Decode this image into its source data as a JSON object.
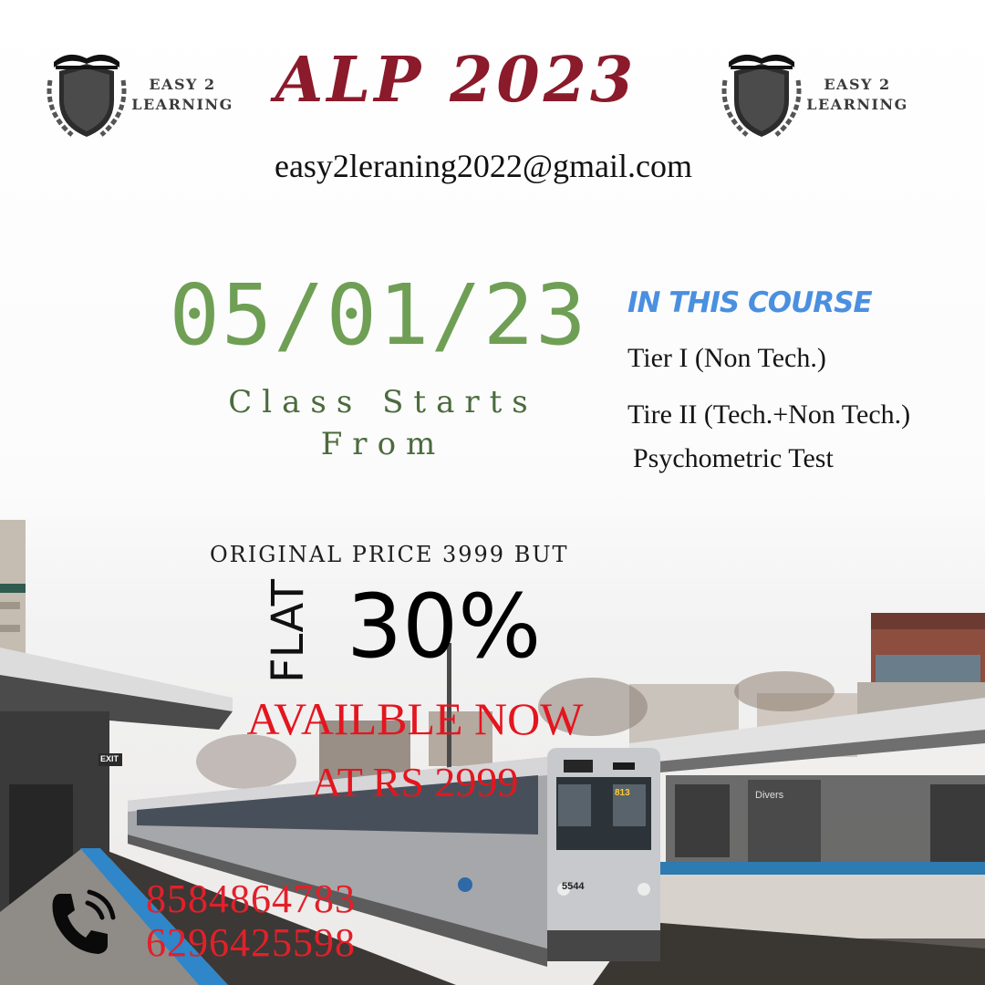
{
  "logo_left": {
    "line1": "EASY 2",
    "line2": "LEARNING"
  },
  "logo_right": {
    "line1": "EASY 2",
    "line2": "LEARNING"
  },
  "title": "ALP 2023",
  "email": "easy2leraning2022@gmail.com",
  "date": "05/01/23",
  "class_starts": {
    "line1": "Class Starts",
    "line2": "From"
  },
  "course": {
    "heading": "IN THIS COURSE",
    "items": [
      "Tier I (Non Tech.)",
      "Tire II (Tech.+Non Tech.)",
      "Psychometric Test"
    ]
  },
  "pricing": {
    "original": "original price 3999 but",
    "flat": "FLAT",
    "discount": "30%",
    "available": "AVAILBLE NOW",
    "price_now": "AT RS 2999"
  },
  "contact": {
    "phones": [
      "8584864783",
      "6296425598"
    ]
  },
  "colors": {
    "title": "#8b1a2b",
    "date": "#6f9f55",
    "class_starts": "#4b6b3c",
    "course_heading": "#4a8fe0",
    "offer": "#e3161f"
  },
  "icons": {
    "logo": "shield-book-laurel-icon",
    "contact": "phone-ringing-icon"
  },
  "scene": {
    "train_number": "5544",
    "route_sign": "813",
    "station_sign": "Divers",
    "exit_sign": "EXIT"
  }
}
